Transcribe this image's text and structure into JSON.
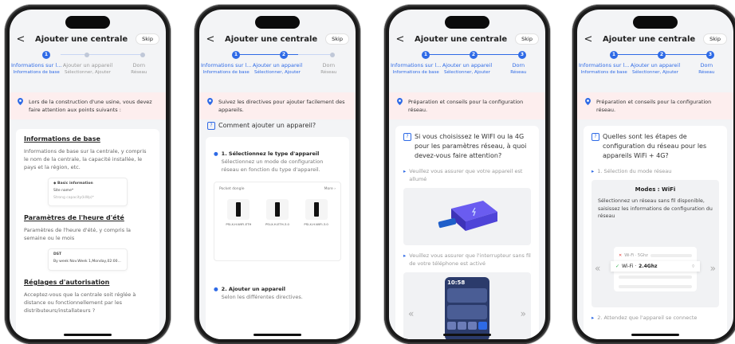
{
  "title": "Ajouter une centrale",
  "skip": "Skip",
  "back": "<",
  "steps": [
    {
      "num": "1",
      "label": "Informations sur l...",
      "sub": "Informations de base"
    },
    {
      "num": "2",
      "label": "Ajouter un appareil",
      "sub": "Sélectionner, Ajouter"
    },
    {
      "num": "3",
      "label": "Dorn",
      "sub": "Réseau"
    }
  ],
  "colors": {
    "accent": "#2e6ae6",
    "tip_bg": "#fdeeee"
  },
  "screen1": {
    "tip": "Lors de la construction d'une usine, vous devez faire attention aux points suivants :",
    "s1_title": "Informations de base",
    "s1_desc": "Informations de base sur la centrale, y compris le nom de la centrale, la capacité installée, le pays et la région, etc.",
    "card1_head": "Basic information",
    "card1_field": "Site name*",
    "card1_foot": "Strong capacity(kWp)*",
    "s2_title": "Paramètres de l'heure d'été",
    "s2_desc": "Paramètres de l'heure d'été, y compris la semaine ou le mois",
    "card2_head": "DST",
    "card2_val": "By week  Nov.Week 1,Monday,02:00...",
    "s3_title": "Réglages d'autorisation",
    "s3_desc": "Acceptez-vous que la centrale soit réglée à distance ou fonctionnellement par les distributeurs/installateurs ?"
  },
  "screen2": {
    "tip": "Suivez les directives pour ajouter facilement des appareils.",
    "question": "Comment ajouter un appareil?",
    "b1_title": "1. Sélectionnez le type d'appareil",
    "b1_desc": "Sélectionnez un mode de configuration réseau en fonction du type d'appareil.",
    "pick_label": "Pocket dongle",
    "pick_more": "More ›",
    "devices": [
      "PSI-X-H-WIFI-ETH",
      "PSI-X-H-ETH-3.0",
      "PSI-X-H-WIFI-3.0"
    ],
    "b2_title": "2. Ajouter un appareil",
    "b2_desc": "Selon les différentes directives."
  },
  "screen3": {
    "tip": "Préparation et conseils pour la configuration réseau.",
    "question": "Si vous choisissez le WIFI ou la 4G pour les paramètres réseau, à quoi devez-vous faire attention?",
    "b1": "Veuillez vous assurer que votre appareil est allumé",
    "b2": "Veuillez vous assurer que l'interrupteur sans fil de votre téléphone est activé",
    "phone_time": "10:58"
  },
  "screen4": {
    "tip": "Préparation et conseils pour la configuration réseau.",
    "question": "Quelles sont les étapes de configuration du réseau pour les appareils WiFi + 4G?",
    "b1": "1. Sélection du mode réseau",
    "mode_title": "Modes : WiFi",
    "mode_desc": "Sélectionnez un réseau sans fil disponible, saisissez les informations de configuration du réseau",
    "wifi_bad": "Wi-Fi · 5Ghz",
    "wifi_good_a": "Wi-Fi · ",
    "wifi_good_b": "2.4Ghz",
    "b2": "2. Attendez que l'appareil se connecte"
  }
}
